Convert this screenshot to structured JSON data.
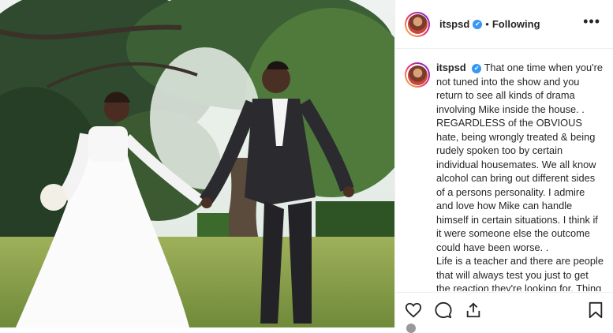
{
  "post": {
    "username": "itspsd",
    "verified_mark": "✔",
    "separator": "•",
    "follow_status": "Following",
    "more_glyph": "•••",
    "caption_username": "itspsd",
    "caption_lines": [
      "That one time when you're not tuned into the show and you return to see all kinds of drama involving Mike inside the house. . REGARDLESS of the OBVIOUS hate, being wrongly treated & being rudely spoken too by certain individual housemates. We all know alcohol can bring out different sides of a persons personality. I admire and love how Mike can handle himself in certain situations. I think if it were someone else the outcome could have been worse. .",
      "Life is a teacher and there are people that will always test you just to get the reaction they're looking for. Thing is it's how you react that shows true CHARACTER & what makes you the"
    ]
  },
  "photo": {
    "icon": "wedding-photo"
  },
  "actions": {
    "like_icon": "heart-icon",
    "comment_icon": "comment-icon",
    "share_icon": "share-icon",
    "save_icon": "bookmark-icon"
  },
  "colors": {
    "verified": "#3897f0",
    "text": "#262626",
    "border": "#efefef"
  }
}
